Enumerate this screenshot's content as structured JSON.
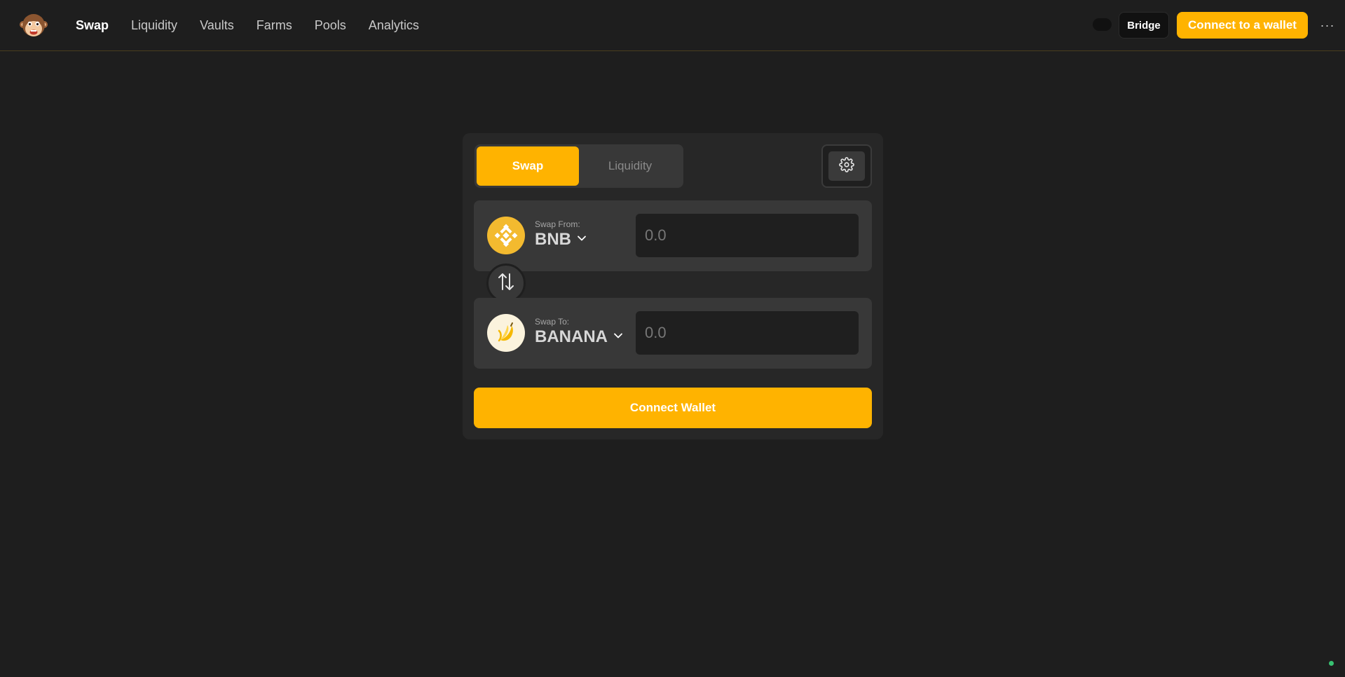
{
  "nav": {
    "logo_icon": "monkey-logo-icon",
    "links": [
      {
        "label": "Swap",
        "active": true
      },
      {
        "label": "Liquidity",
        "active": false
      },
      {
        "label": "Vaults",
        "active": false
      },
      {
        "label": "Farms",
        "active": false
      },
      {
        "label": "Pools",
        "active": false
      },
      {
        "label": "Analytics",
        "active": false
      }
    ],
    "bridge_label": "Bridge",
    "connect_label": "Connect to a wallet",
    "more_label": "···"
  },
  "swap_card": {
    "tabs": {
      "active_label": "Swap",
      "inactive_label": "Liquidity"
    },
    "settings_icon": "gear-icon",
    "from": {
      "label": "Swap From:",
      "symbol": "BNB",
      "icon": "bnb-token-icon",
      "placeholder": "0.0"
    },
    "to": {
      "label": "Swap To:",
      "symbol": "BANANA",
      "icon": "banana-token-icon",
      "placeholder": "0.0"
    },
    "switch_icon": "swap-arrows-icon",
    "connect_wallet_label": "Connect Wallet"
  },
  "colors": {
    "accent": "#ffb300",
    "background": "#1e1e1e",
    "card": "#272727",
    "panel": "#383838",
    "status": "#38c172"
  }
}
